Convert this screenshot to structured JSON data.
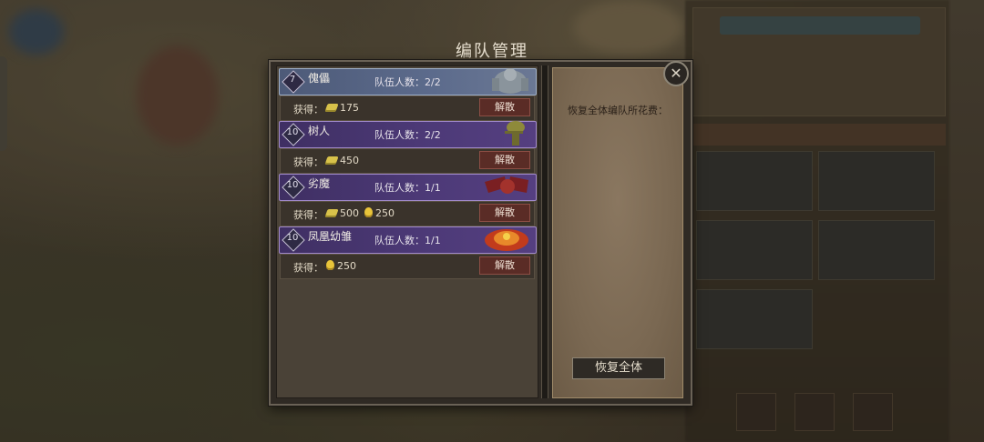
{
  "dialog": {
    "title": "编队管理",
    "close_icon": "close-icon",
    "restore_cost_label": "恢复全体编队所花费：",
    "restore_all_button": "恢复全体"
  },
  "teams": [
    {
      "level": "7",
      "name": "傀儡",
      "count_text": "队伍人数：2/2",
      "style": "blue",
      "reward_label": "获得：",
      "rewards": [
        {
          "icon": "wood-icon",
          "amount": "175"
        }
      ],
      "disband_label": "解散"
    },
    {
      "level": "10",
      "name": "树人",
      "count_text": "队伍人数：2/2",
      "style": "purple",
      "reward_label": "获得：",
      "rewards": [
        {
          "icon": "wood-icon",
          "amount": "450"
        }
      ],
      "disband_label": "解散"
    },
    {
      "level": "10",
      "name": "劣魔",
      "count_text": "队伍人数：1/1",
      "style": "purple",
      "reward_label": "获得：",
      "rewards": [
        {
          "icon": "wood-icon",
          "amount": "500"
        },
        {
          "icon": "gold-icon",
          "amount": "250"
        }
      ],
      "disband_label": "解散"
    },
    {
      "level": "10",
      "name": "凤凰幼雏",
      "count_text": "队伍人数：1/1",
      "style": "purple",
      "reward_label": "获得：",
      "rewards": [
        {
          "icon": "gold-icon",
          "amount": "250"
        }
      ],
      "disband_label": "解散"
    }
  ],
  "colors": {
    "blue_team": "#5c6b8c",
    "purple_team": "#4d3a78",
    "disband_button": "#5a2c26",
    "parchment": "#7a6852"
  }
}
